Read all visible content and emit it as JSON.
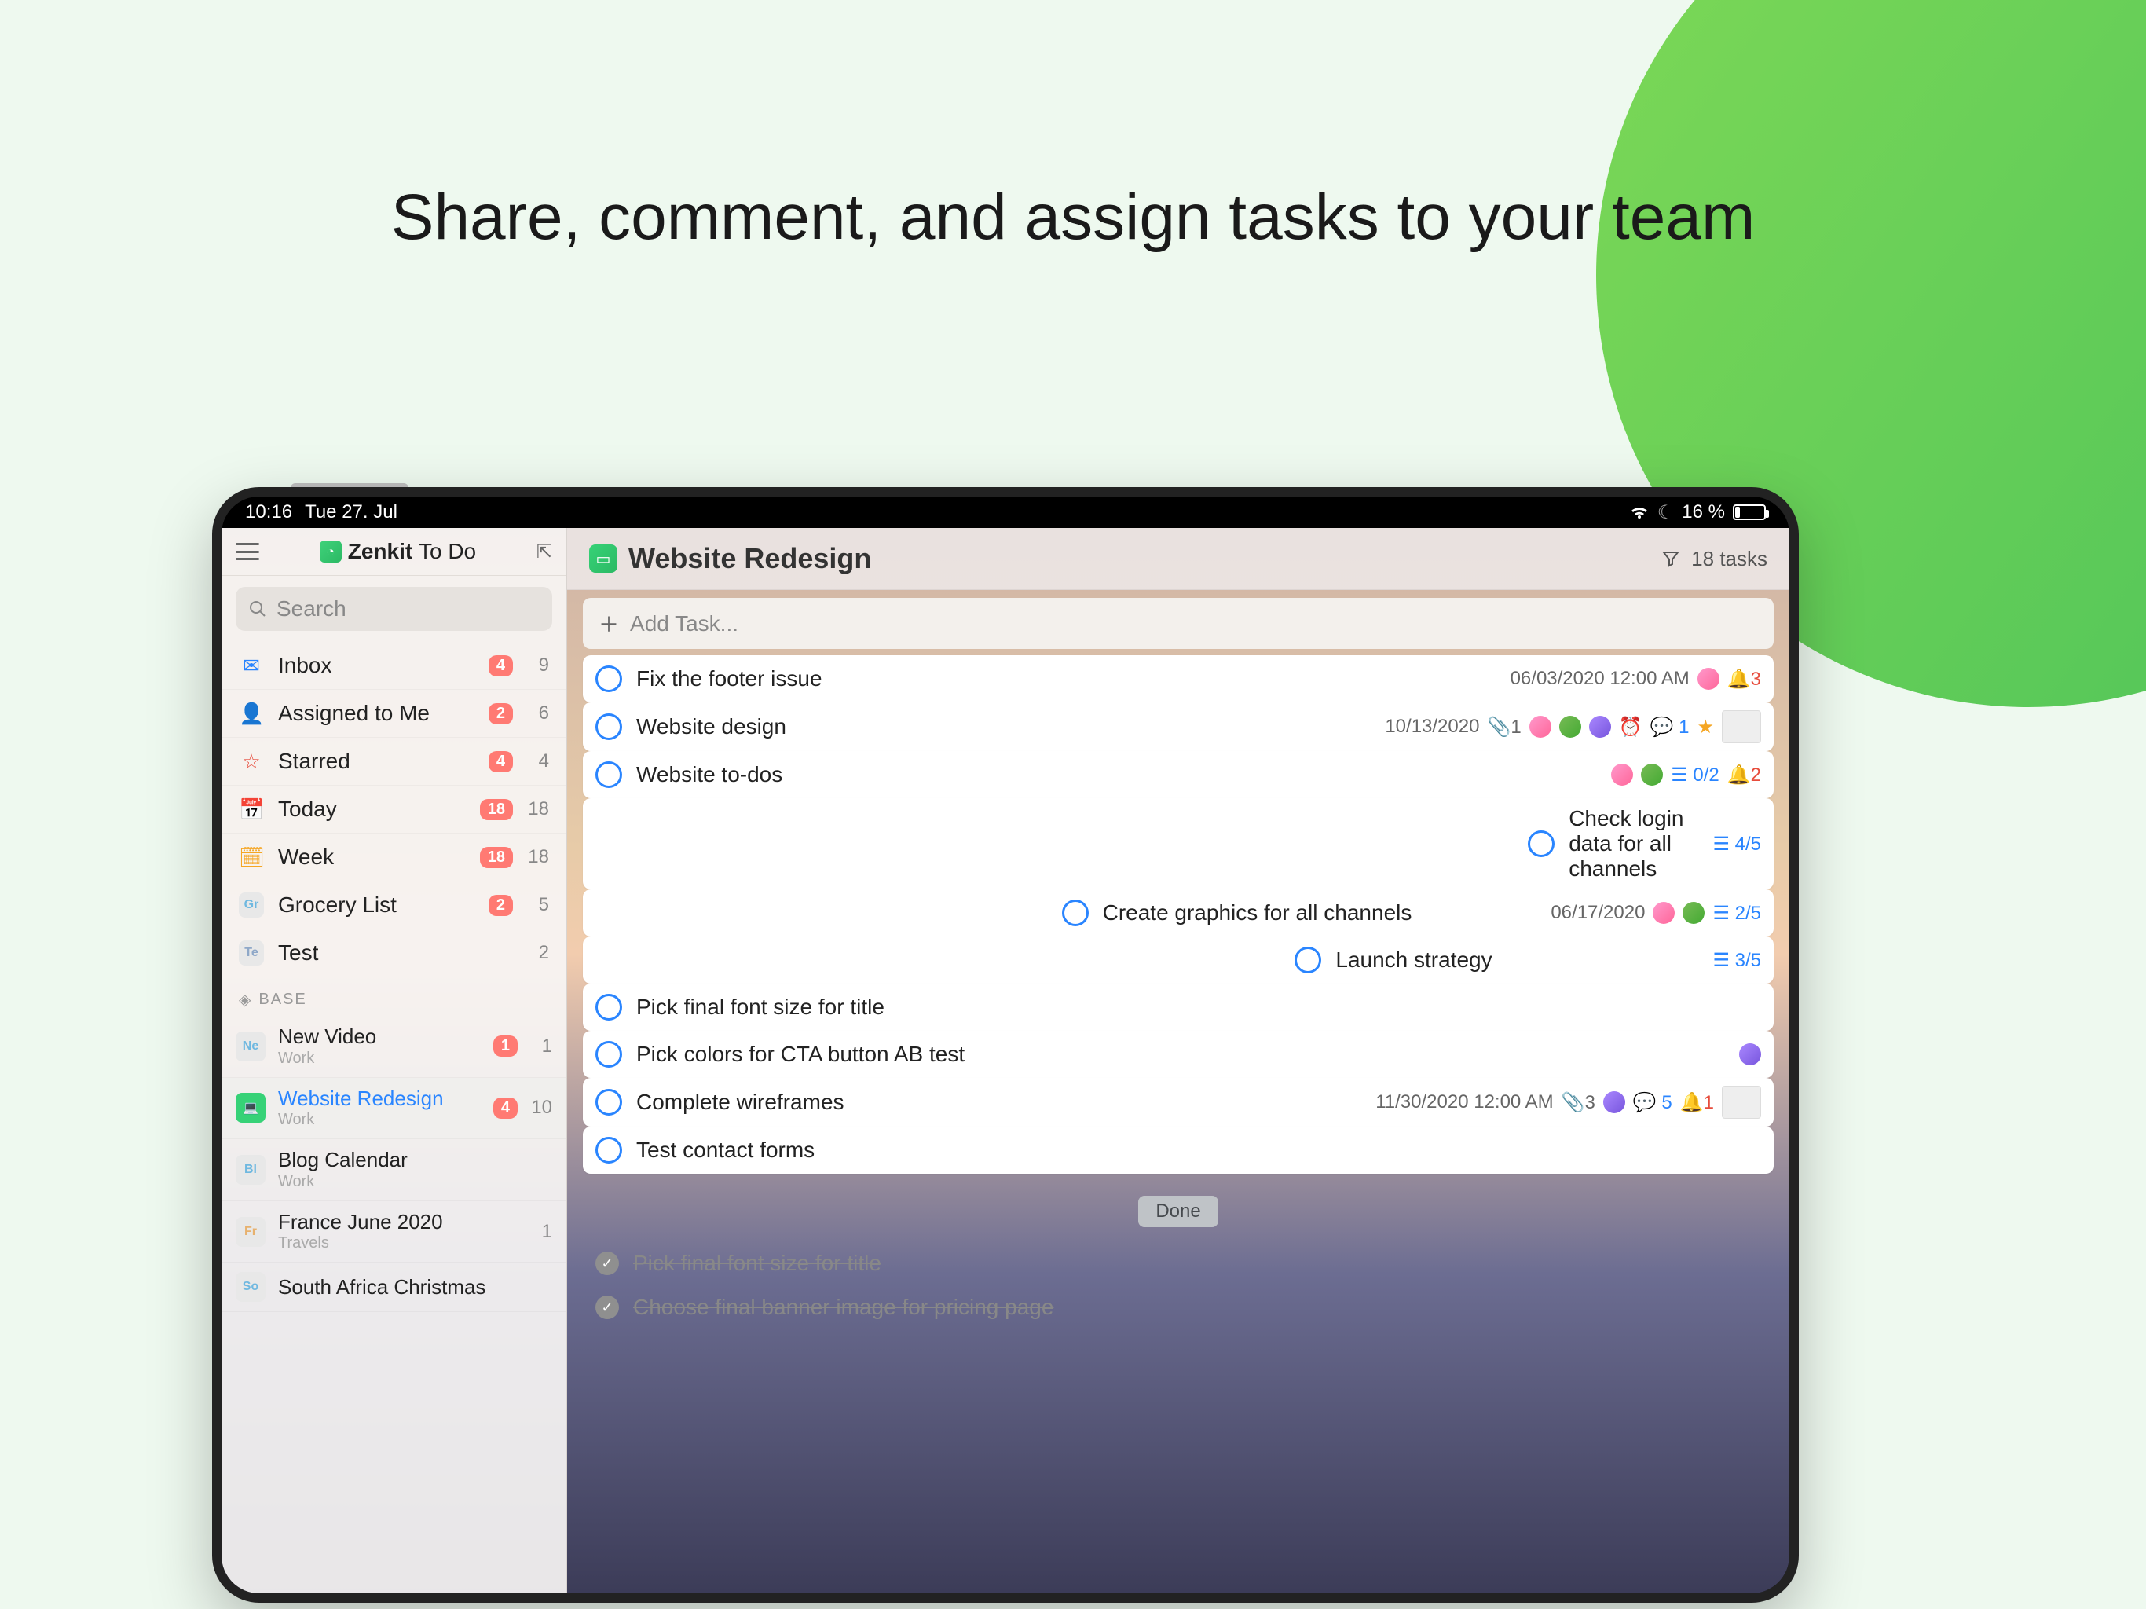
{
  "headline": "Share, comment, and assign tasks to your team",
  "statusbar": {
    "time": "10:16",
    "date": "Tue 27. Jul",
    "battery_text": "16 %"
  },
  "sidebar": {
    "app_name_strong": "Zenkit",
    "app_name_light": "To Do",
    "search_placeholder": "Search",
    "smart": [
      {
        "icon": "✉",
        "icon_color": "#2a85ff",
        "label": "Inbox",
        "badge": "4",
        "count": "9"
      },
      {
        "icon": "👤",
        "icon_color": "#8a4fd8",
        "label": "Assigned to Me",
        "badge": "2",
        "count": "6"
      },
      {
        "icon": "☆",
        "icon_color": "#e74c3c",
        "label": "Starred",
        "badge": "4",
        "count": "4"
      },
      {
        "icon": "📅",
        "icon_color": "#2cb964",
        "label": "Today",
        "badge": "18",
        "count": "18"
      },
      {
        "icon": "🗓",
        "icon_color": "#f5a623",
        "label": "Week",
        "badge": "18",
        "count": "18"
      },
      {
        "tag": "Gr",
        "tag_color": "#6fb8e0",
        "label": "Grocery List",
        "badge": "2",
        "count": "5"
      },
      {
        "tag": "Te",
        "tag_color": "#8fa8c8",
        "label": "Test",
        "badge": "",
        "count": "2"
      }
    ],
    "section_label": "BASE",
    "base": [
      {
        "tag": "Ne",
        "tag_color": "#6fb8e0",
        "name": "New Video",
        "sub": "Work",
        "badge": "1",
        "count": "1",
        "active": false
      },
      {
        "tag": "💻",
        "tag_color": "#36d277",
        "name": "Website Redesign",
        "sub": "Work",
        "badge": "4",
        "count": "10",
        "active": true
      },
      {
        "tag": "Bl",
        "tag_color": "#6fb8e0",
        "name": "Blog Calendar",
        "sub": "Work",
        "badge": "",
        "count": "",
        "active": false
      },
      {
        "tag": "Fr",
        "tag_color": "#e7b16e",
        "name": "France June 2020",
        "sub": "Travels",
        "badge": "",
        "count": "1",
        "active": false
      },
      {
        "tag": "So",
        "tag_color": "#6fb8e0",
        "name": "South Africa Christmas",
        "sub": "",
        "badge": "",
        "count": "",
        "active": false
      }
    ]
  },
  "main": {
    "title": "Website Redesign",
    "task_count": "18 tasks",
    "add_task_label": "Add Task...",
    "tasks": [
      {
        "title": "Fix the footer issue",
        "date": "06/03/2020 12:00 AM",
        "avatars": [
          "av1"
        ],
        "bell": "3",
        "bell_red": true,
        "progress": 0
      },
      {
        "title": "Website design",
        "date": "10/13/2020",
        "clip": "1",
        "avatars": [
          "av1",
          "av2",
          "av3"
        ],
        "alarm": true,
        "chat": "1",
        "chat_blue": true,
        "star": true,
        "thumb": true,
        "progress": 0
      },
      {
        "title": "Website to-dos",
        "avatars": [
          "av1",
          "av2"
        ],
        "sub": "0/2",
        "sub_blue": true,
        "bell": "2",
        "bell_red": true,
        "progress": 0
      },
      {
        "title": "Check login data for all channels",
        "sub": "4/5",
        "sub_blue": true,
        "progress": 80
      },
      {
        "title": "Create graphics for all channels",
        "date": "06/17/2020",
        "avatars": [
          "av1",
          "av2"
        ],
        "sub": "2/5",
        "sub_blue": true,
        "progress": 40
      },
      {
        "title": "Launch strategy",
        "sub": "3/5",
        "sub_blue": true,
        "progress": 60
      },
      {
        "title": "Pick final font size for title",
        "progress": 0
      },
      {
        "title": "Pick colors for CTA button AB test",
        "avatars": [
          "av3"
        ],
        "progress": 0
      },
      {
        "title": "Complete wireframes",
        "date": "11/30/2020 12:00 AM",
        "clip": "3",
        "avatars": [
          "av3"
        ],
        "chat": "5",
        "chat_blue": true,
        "bell": "1",
        "bell_red": true,
        "thumb": true,
        "progress": 0
      },
      {
        "title": "Test contact forms",
        "progress": 0
      }
    ],
    "done_label": "Done",
    "done": [
      {
        "title": "Pick final font size for title"
      },
      {
        "title": "Choose final banner image for pricing page"
      }
    ]
  }
}
